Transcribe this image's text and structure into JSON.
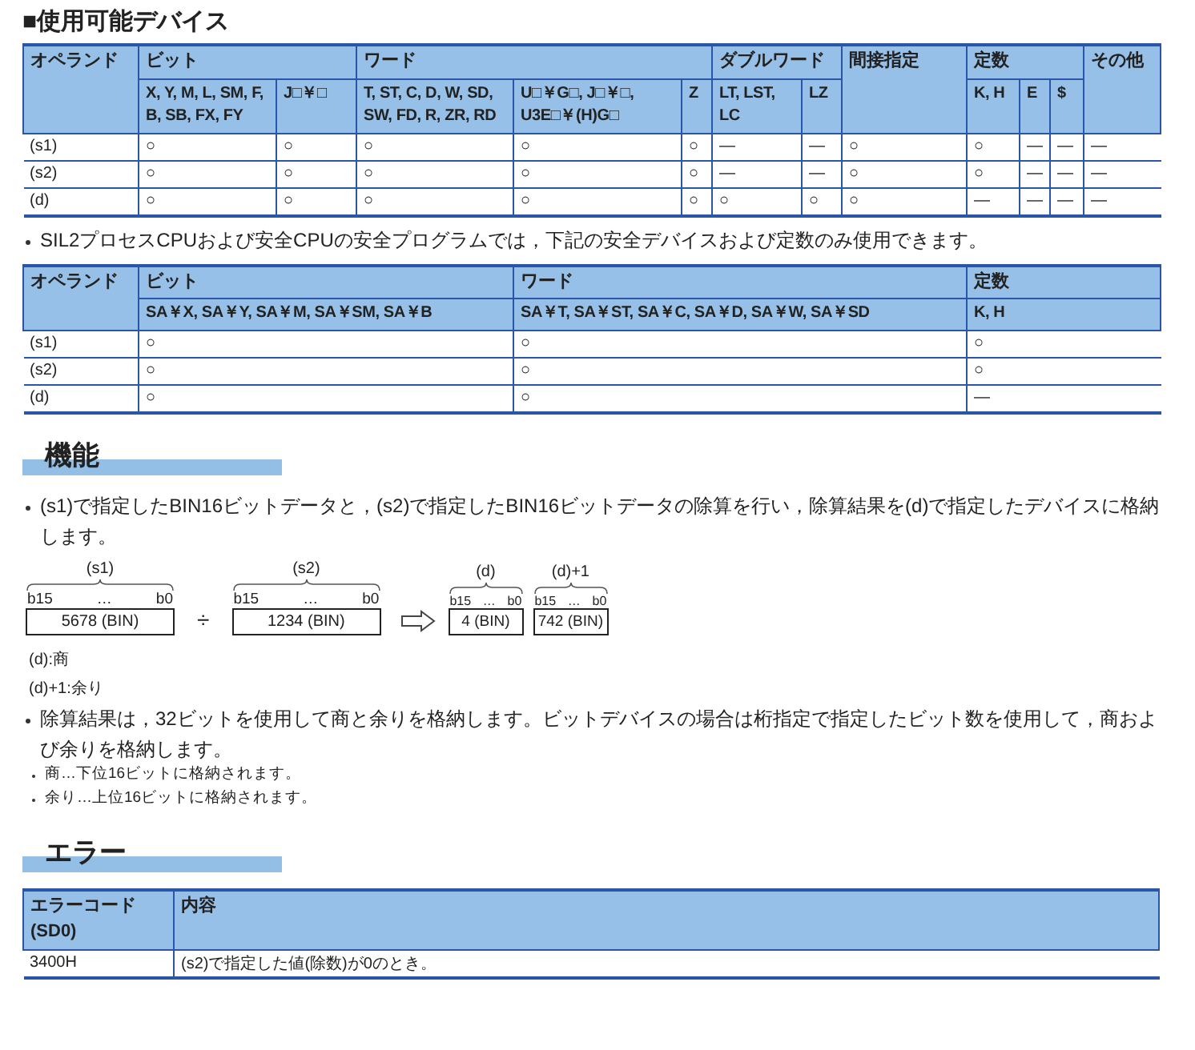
{
  "title": "■使用可能デバイス",
  "device_table": {
    "groups": [
      {
        "label": "オペランド"
      },
      {
        "label": "ビット",
        "columns": [
          "X, Y, M, L, SM, F, B, SB, FX, FY",
          "J□￥□"
        ]
      },
      {
        "label": "ワード",
        "columns": [
          "T, ST, C, D, W, SD, SW, FD, R, ZR, RD",
          "U□￥G□, J□￥□, U3E□￥(H)G□",
          "Z"
        ]
      },
      {
        "label": "ダブルワード",
        "columns": [
          "LT, LST, LC",
          "LZ"
        ]
      },
      {
        "label": "間接指定"
      },
      {
        "label": "定数",
        "columns": [
          "K, H",
          "E",
          "$"
        ]
      },
      {
        "label": "その他"
      }
    ],
    "rows": [
      {
        "operand": "(s1)",
        "cells": [
          "○",
          "○",
          "○",
          "○",
          "○",
          "—",
          "—",
          "○",
          "○",
          "—",
          "—",
          "—"
        ]
      },
      {
        "operand": "(s2)",
        "cells": [
          "○",
          "○",
          "○",
          "○",
          "○",
          "—",
          "—",
          "○",
          "○",
          "—",
          "—",
          "—"
        ]
      },
      {
        "operand": "(d)",
        "cells": [
          "○",
          "○",
          "○",
          "○",
          "○",
          "○",
          "○",
          "○",
          "—",
          "—",
          "—",
          "—"
        ]
      }
    ]
  },
  "safety_note": "SIL2プロセスCPUおよび安全CPUの安全プログラムでは，下記の安全デバイスおよび定数のみ使用できます。",
  "safety_table": {
    "groups": [
      {
        "label": "オペランド"
      },
      {
        "label": "ビット",
        "columns": [
          "SA￥X, SA￥Y, SA￥M, SA￥SM, SA￥B"
        ]
      },
      {
        "label": "ワード",
        "columns": [
          "SA￥T, SA￥ST, SA￥C, SA￥D, SA￥W, SA￥SD"
        ]
      },
      {
        "label": "定数",
        "columns": [
          "K, H"
        ]
      }
    ],
    "rows": [
      {
        "operand": "(s1)",
        "cells": [
          "○",
          "○",
          "○"
        ]
      },
      {
        "operand": "(s2)",
        "cells": [
          "○",
          "○",
          "○"
        ]
      },
      {
        "operand": "(d)",
        "cells": [
          "○",
          "○",
          "—"
        ]
      }
    ]
  },
  "function_section": {
    "heading": "機能",
    "description": "(s1)で指定したBIN16ビットデータと，(s2)で指定したBIN16ビットデータの除算を行い，除算結果を(d)で指定したデバイスに格納します。",
    "diagram": {
      "operands": [
        {
          "label": "(s1)",
          "high": "b15",
          "dots": "…",
          "low": "b0",
          "value": "5678 (BIN)",
          "kind": "wide"
        },
        {
          "label": "(s2)",
          "high": "b15",
          "dots": "…",
          "low": "b0",
          "value": "1234 (BIN)",
          "kind": "wide"
        }
      ],
      "operator": "÷",
      "results": [
        {
          "label": "(d)",
          "high": "b15",
          "dots": "…",
          "low": "b0",
          "value": "4 (BIN)",
          "kind": "narrow"
        },
        {
          "label": "(d)+1",
          "high": "b15",
          "dots": "…",
          "low": "b0",
          "value": "742 (BIN)",
          "kind": "narrow"
        }
      ]
    },
    "legend": [
      "(d):商",
      "(d)+1:余り"
    ],
    "result_note": "除算結果は，32ビットを使用して商と余りを格納します。ビットデバイスの場合は桁指定で指定したビット数を使用して，商および余りを格納します。",
    "sub_notes": [
      "商…下位16ビットに格納されます。",
      "余り…上位16ビットに格納されます。"
    ]
  },
  "error_section": {
    "heading": "エラー",
    "columns": [
      "エラーコード(SD0)",
      "内容"
    ],
    "rows": [
      {
        "code": "3400H",
        "description": "(s2)で指定した値(除数)が0のとき。"
      }
    ]
  }
}
